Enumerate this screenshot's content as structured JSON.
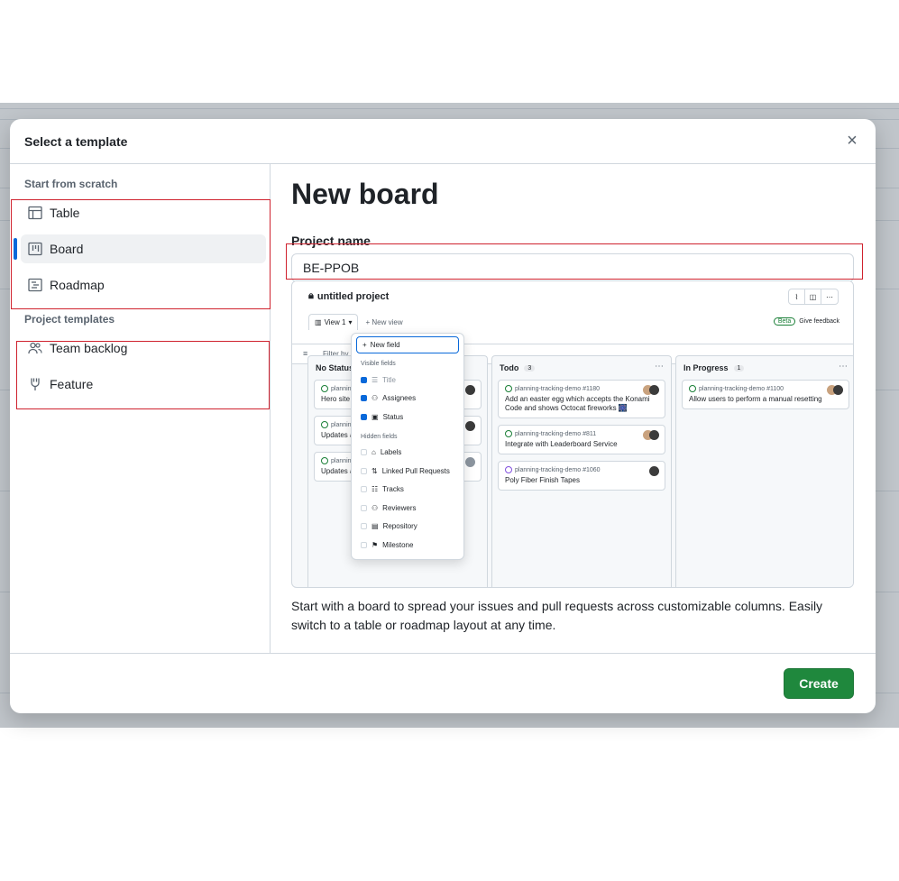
{
  "dialog": {
    "title": "Select a template",
    "close_label": "×"
  },
  "sidebar": {
    "scratch_label": "Start from scratch",
    "scratch_items": [
      {
        "label": "Table",
        "icon": "table-icon"
      },
      {
        "label": "Board",
        "icon": "board-icon",
        "active": true
      },
      {
        "label": "Roadmap",
        "icon": "roadmap-icon"
      }
    ],
    "templates_label": "Project templates",
    "template_items": [
      {
        "label": "Team backlog",
        "icon": "people-icon"
      },
      {
        "label": "Feature",
        "icon": "feature-icon"
      }
    ]
  },
  "main": {
    "heading": "New board",
    "project_name_label": "Project name",
    "project_name_value": "BE-PPOB",
    "description": "Start with a board to spread your issues and pull requests across customizable columns. Easily switch to a table or roadmap layout at any time."
  },
  "preview": {
    "project_title": "untitled project",
    "view_tab": "View 1",
    "new_view": "New view",
    "beta": "Beta",
    "feedback": "Give feedback",
    "filter": "Filter by",
    "columns": [
      {
        "name": "No Status",
        "count": "",
        "cards": [
          {
            "ref": "plannin",
            "title": "Hero site"
          },
          {
            "ref": "plannin",
            "title": "Updates a"
          },
          {
            "ref": "plannin",
            "title": "Updates a"
          }
        ]
      },
      {
        "name": "Todo",
        "count": "3",
        "cards": [
          {
            "ref": "planning-tracking-demo #1180",
            "title": "Add an easter egg which accepts the Konami Code and shows Octocat fireworks 🎆"
          },
          {
            "ref": "planning-tracking-demo #811",
            "title": "Integrate with Leaderboard Service"
          },
          {
            "ref": "planning-tracking-demo #1060",
            "title": "Poly Fiber Finish Tapes"
          }
        ]
      },
      {
        "name": "In Progress",
        "count": "1",
        "cards": [
          {
            "ref": "planning-tracking-demo #1100",
            "title": "Allow users to perform a manual resetting"
          }
        ]
      }
    ],
    "dropdown": {
      "new_field": "New field",
      "visible_label": "Visible fields",
      "visible": [
        "Title",
        "Assignees",
        "Status"
      ],
      "hidden_label": "Hidden fields",
      "hidden": [
        "Labels",
        "Linked Pull Requests",
        "Tracks",
        "Reviewers",
        "Repository",
        "Milestone"
      ]
    }
  },
  "footer": {
    "create_label": "Create"
  },
  "colors": {
    "accent": "#0969da",
    "primary_button": "#1f883d",
    "selection_outline": "#cf222e"
  }
}
